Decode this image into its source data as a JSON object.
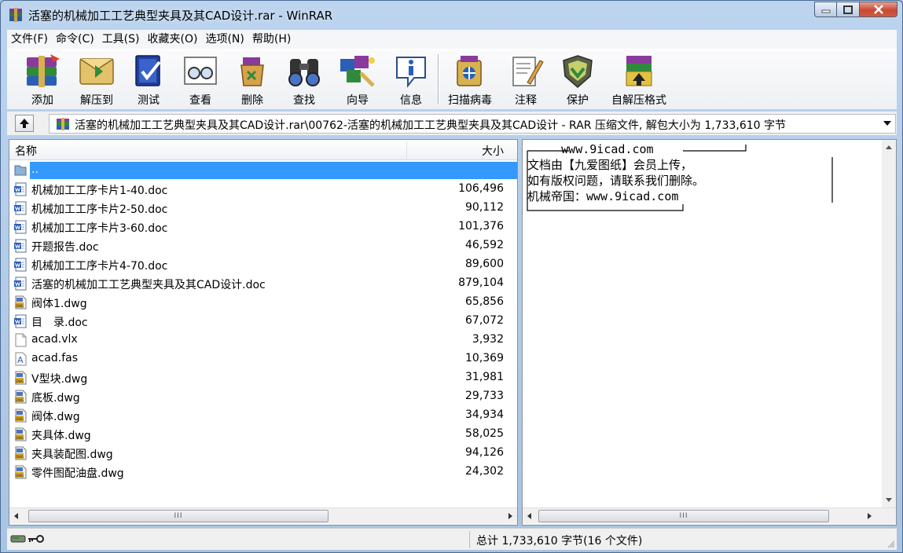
{
  "window": {
    "title": "活塞的机械加工工艺典型夹具及其CAD设计.rar - WinRAR"
  },
  "menu": [
    "文件(F)",
    "命令(C)",
    "工具(S)",
    "收藏夹(O)",
    "选项(N)",
    "帮助(H)"
  ],
  "toolbar": [
    {
      "label": "添加",
      "icon": "add-archive-icon"
    },
    {
      "label": "解压到",
      "icon": "extract-icon"
    },
    {
      "label": "测试",
      "icon": "test-icon"
    },
    {
      "label": "查看",
      "icon": "view-icon"
    },
    {
      "label": "删除",
      "icon": "delete-icon"
    },
    {
      "label": "查找",
      "icon": "find-icon"
    },
    {
      "label": "向导",
      "icon": "wizard-icon"
    },
    {
      "label": "信息",
      "icon": "info-icon"
    },
    {
      "label": "扫描病毒",
      "icon": "virus-scan-icon"
    },
    {
      "label": "注释",
      "icon": "comment-icon"
    },
    {
      "label": "保护",
      "icon": "protect-icon"
    },
    {
      "label": "自解压格式",
      "icon": "sfx-icon"
    }
  ],
  "path": {
    "text": "活塞的机械加工工艺典型夹具及其CAD设计.rar\\00762-活塞的机械加工工艺典型夹具及其CAD设计 - RAR 压缩文件, 解包大小为 1,733,610 字节"
  },
  "columns": {
    "name": "名称",
    "size": "大小"
  },
  "files": [
    {
      "name": "..",
      "size": "",
      "type": "folder-up",
      "selected": true
    },
    {
      "name": "机械加工工序卡片1-40.doc",
      "size": "106,496",
      "type": "doc"
    },
    {
      "name": "机械加工工序卡片2-50.doc",
      "size": "90,112",
      "type": "doc"
    },
    {
      "name": "机械加工工序卡片3-60.doc",
      "size": "101,376",
      "type": "doc"
    },
    {
      "name": "开题报告.doc",
      "size": "46,592",
      "type": "doc"
    },
    {
      "name": "机械加工工序卡片4-70.doc",
      "size": "89,600",
      "type": "doc"
    },
    {
      "name": "活塞的机械加工工艺典型夹具及其CAD设计.doc",
      "size": "879,104",
      "type": "doc"
    },
    {
      "name": "阀体1.dwg",
      "size": "65,856",
      "type": "dwg"
    },
    {
      "name": "目　录.doc",
      "size": "67,072",
      "type": "doc"
    },
    {
      "name": "acad.vlx",
      "size": "3,932",
      "type": "blank"
    },
    {
      "name": "acad.fas",
      "size": "10,369",
      "type": "fas"
    },
    {
      "name": "V型块.dwg",
      "size": "31,981",
      "type": "dwg"
    },
    {
      "name": "底板.dwg",
      "size": "29,733",
      "type": "dwg"
    },
    {
      "name": "阀体.dwg",
      "size": "34,934",
      "type": "dwg"
    },
    {
      "name": "夹具体.dwg",
      "size": "58,025",
      "type": "dwg"
    },
    {
      "name": "夹具装配图.dwg",
      "size": "94,126",
      "type": "dwg"
    },
    {
      "name": "零件图配油盘.dwg",
      "size": "24,302",
      "type": "dwg"
    }
  ],
  "comment": {
    "lines": [
      "     www.9icad.com",
      "文档由【九爱图纸】会员上传，",
      "如有版权问题，请联系我们删除。",
      "机械帝国：www.9icad.com"
    ]
  },
  "status": {
    "total": "总计 1,733,610 字节(16 个文件)"
  },
  "colors": {
    "selection": "#3399ff",
    "title_bg": "#bcd4ee",
    "close_btn": "#c74a32"
  }
}
